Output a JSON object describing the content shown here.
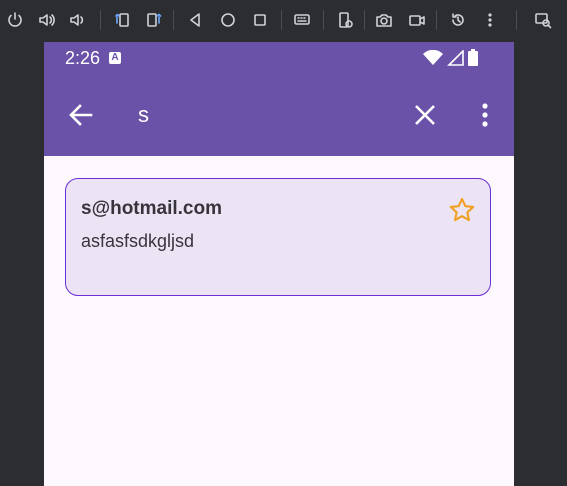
{
  "status_bar": {
    "time": "2:26",
    "notification_glyph": "A"
  },
  "app_bar": {
    "search_value": "s"
  },
  "results": [
    {
      "email": "s@hotmail.com",
      "text": "asfasfsdkgljsd",
      "starred": false
    }
  ],
  "colors": {
    "primary": "#6a52a8",
    "card_bg": "#ece4f4",
    "card_border": "#6a2fd6",
    "star": "#f0a020",
    "screen_bg": "#fdf7fe"
  },
  "toolbar_icons": [
    "power-icon",
    "volume-up-icon",
    "volume-down-icon",
    "rotate-left-icon",
    "rotate-right-icon",
    "back-icon",
    "home-icon",
    "overview-icon",
    "keyboard-icon",
    "device-settings-icon",
    "camera-icon",
    "video-icon",
    "reset-icon",
    "more-icon",
    "zoom-icon"
  ]
}
